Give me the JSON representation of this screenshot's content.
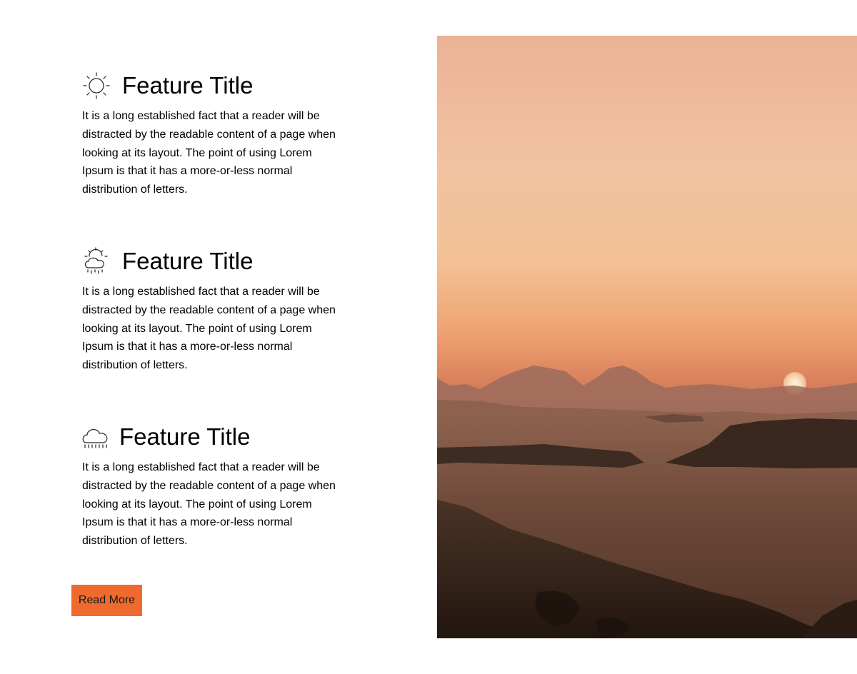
{
  "features": [
    {
      "icon": "sun-icon",
      "title": "Feature Title",
      "text": "It is a long established fact that a reader will be distracted by the readable content of a page when looking at its layout. The point of using Lorem Ipsum is that it has a more-or-less normal distribution of letters."
    },
    {
      "icon": "cloud-sun-rain-icon",
      "title": "Feature Title",
      "text": "It is a long established fact that a reader will be distracted by the readable content of a page when looking at its layout. The point of using Lorem Ipsum is that it has a more-or-less normal distribution of letters."
    },
    {
      "icon": "cloud-rain-icon",
      "title": "Feature Title",
      "text": "It is a long established fact that a reader will be distracted by the readable content of a page when looking at its layout. The point of using Lorem Ipsum is that it has a more-or-less normal distribution of letters."
    }
  ],
  "cta": {
    "read_more_label": "Read More",
    "color": "#ee6a2e"
  },
  "hero": {
    "subject": "desert sunset landscape"
  }
}
